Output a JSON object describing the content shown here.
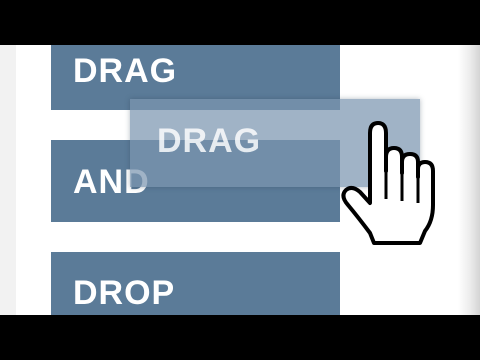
{
  "blocks": [
    {
      "label": "DRAG"
    },
    {
      "label": "AND"
    },
    {
      "label": "DROP"
    }
  ],
  "dragged_item": {
    "label": "DRAG"
  },
  "cursor": {
    "icon": "hand-pointer-icon"
  },
  "colors": {
    "block": "#5b7b98",
    "ghost": "#7b96b0",
    "text": "#ffffff",
    "letterbox": "#000000"
  }
}
